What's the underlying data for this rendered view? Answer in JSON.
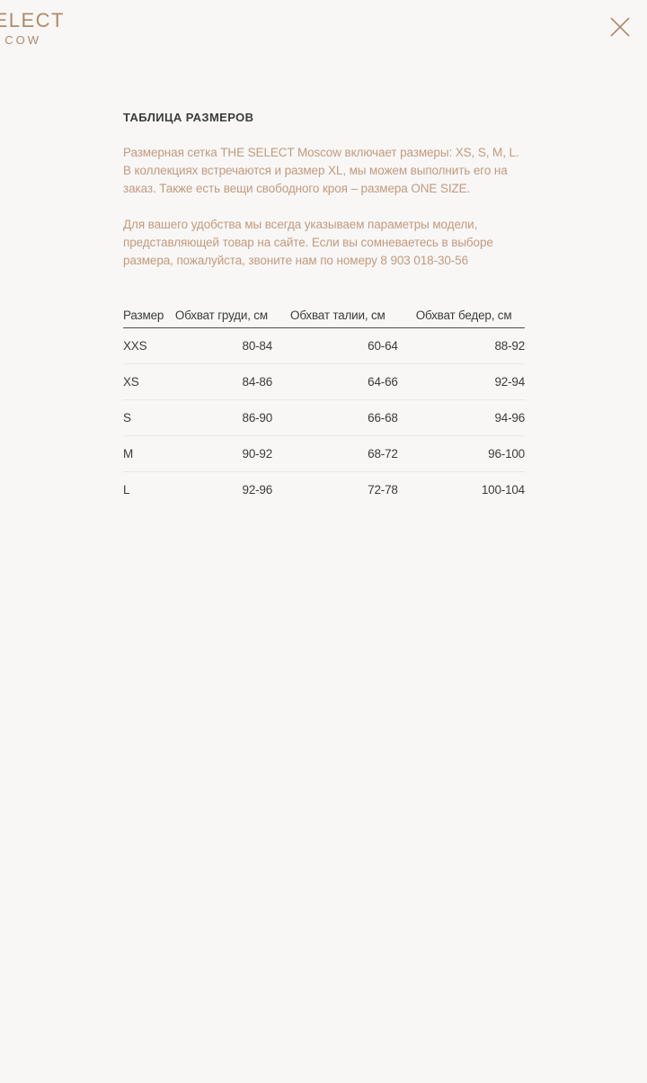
{
  "logo": {
    "line1": "ELECT",
    "line2": "COW"
  },
  "close": {
    "icon": "close-icon"
  },
  "colors": {
    "background": "#f8f7f5",
    "accent": "#c29a7f",
    "text": "#3c3c3c"
  },
  "title": "ТАБЛИЦА РАЗМЕРОВ",
  "paragraphs": [
    "Размерная сетка THE SELECT Moscow включает размеры: XS, S, M, L. В коллекциях встречаются и размер XL, мы можем выполнить его на заказ. Также есть вещи свободного кроя – размера ONE SIZE.",
    "Для вашего удобства мы всегда указываем параметры модели, представляющей товар на сайте. Если вы сомневаетесь в выборе размера, пожалуйста, звоните нам по номеру 8 903 018-30-56"
  ],
  "table": {
    "headers": [
      "Размер",
      "Обхват груди, см",
      "Обхват талии, см",
      "Обхват бедер, см"
    ],
    "rows": [
      [
        "XXS",
        "80-84",
        "60-64",
        "88-92"
      ],
      [
        "XS",
        "84-86",
        "64-66",
        "92-94"
      ],
      [
        "S",
        "86-90",
        "66-68",
        "94-96"
      ],
      [
        "M",
        "90-92",
        "68-72",
        "96-100"
      ],
      [
        "L",
        "92-96",
        "72-78",
        "100-104"
      ]
    ]
  }
}
